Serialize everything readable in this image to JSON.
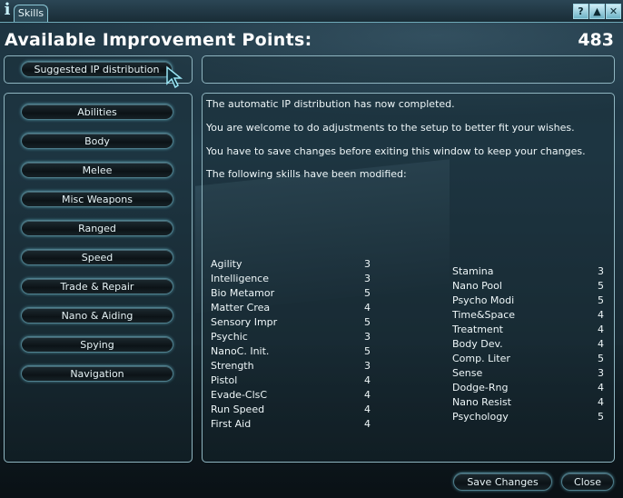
{
  "window": {
    "tab_label": "Skills",
    "info_icon": "i",
    "buttons": [
      {
        "name": "help",
        "label": "?"
      },
      {
        "name": "pin",
        "label": "▲"
      },
      {
        "name": "close",
        "label": "✕"
      }
    ]
  },
  "header": {
    "title": "Available Improvement Points:",
    "points": "483"
  },
  "suggest_button": "Suggested IP distribution",
  "categories": [
    "Abilities",
    "Body",
    "Melee",
    "Misc Weapons",
    "Ranged",
    "Speed",
    "Trade & Repair",
    "Nano & Aiding",
    "Spying",
    "Navigation"
  ],
  "messages": [
    "The automatic IP distribution has now completed.",
    "You are welcome to do adjustments to the setup to better fit your wishes.",
    "You have to save changes before exiting this window to keep your changes.",
    "The following skills have been modified:"
  ],
  "modified_left": [
    {
      "skill": "Agility",
      "value": "3"
    },
    {
      "skill": "Intelligence",
      "value": "3"
    },
    {
      "skill": "Bio Metamor",
      "value": "5"
    },
    {
      "skill": "Matter Crea",
      "value": "4"
    },
    {
      "skill": "Sensory Impr",
      "value": "5"
    },
    {
      "skill": "Psychic",
      "value": "3"
    },
    {
      "skill": "NanoC. Init.",
      "value": "5"
    },
    {
      "skill": "Strength",
      "value": "3"
    },
    {
      "skill": "Pistol",
      "value": "4"
    },
    {
      "skill": "Evade-ClsC",
      "value": "4"
    },
    {
      "skill": "Run Speed",
      "value": "4"
    },
    {
      "skill": "First Aid",
      "value": "4"
    }
  ],
  "modified_right": [
    {
      "skill": "Stamina",
      "value": "3"
    },
    {
      "skill": "Nano Pool",
      "value": "5"
    },
    {
      "skill": "Psycho Modi",
      "value": "5"
    },
    {
      "skill": "Time&Space",
      "value": "4"
    },
    {
      "skill": "Treatment",
      "value": "4"
    },
    {
      "skill": "Body Dev.",
      "value": "4"
    },
    {
      "skill": "Comp. Liter",
      "value": "5"
    },
    {
      "skill": "Sense",
      "value": "3"
    },
    {
      "skill": "Dodge-Rng",
      "value": "4"
    },
    {
      "skill": "Nano Resist",
      "value": "4"
    },
    {
      "skill": "Psychology",
      "value": "5"
    }
  ],
  "footer": {
    "save_label": "Save Changes",
    "close_label": "Close"
  }
}
